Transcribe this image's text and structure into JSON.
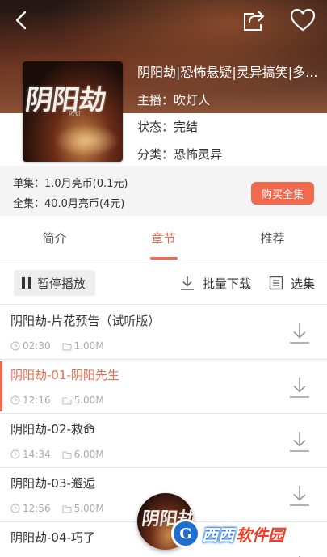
{
  "header": {
    "back_icon": "back-arrow-icon",
    "share_icon": "share-icon",
    "favorite_icon": "heart-icon"
  },
  "book": {
    "cover_text": "阴阳劫",
    "cover_author": "吹灯",
    "title": "阴阳劫|恐怖悬疑|灵异搞笑|多...",
    "host_label": "主播：",
    "host": "吹灯人",
    "status_label": "状态：",
    "status": "完结",
    "category_label": "分类：",
    "category": "恐怖灵异"
  },
  "price": {
    "single": "单集：1.0月亮币(0.1元)",
    "full": "全集：40.0月亮币(4元)",
    "buy_label": "购买全集"
  },
  "tabs": [
    {
      "label": "简介",
      "active": false
    },
    {
      "label": "章节",
      "active": true
    },
    {
      "label": "推荐",
      "active": false
    }
  ],
  "toolbar": {
    "pause_label": "暂停播放",
    "batch_download_label": "批量下载",
    "select_label": "选集"
  },
  "episodes": [
    {
      "title": "阴阳劫-片花预告（试听版）",
      "duration": "02:30",
      "size": "1.00M",
      "active": false
    },
    {
      "title": "阴阳劫-01-阴阳先生",
      "duration": "12:16",
      "size": "5.00M",
      "active": true
    },
    {
      "title": "阴阳劫-02-救命",
      "duration": "14:34",
      "size": "6.00M",
      "active": false
    },
    {
      "title": "阴阳劫-03-邂逅",
      "duration": "12:56",
      "size": "5.00M",
      "active": false
    },
    {
      "title": "阴阳劫-04-巧了",
      "duration": "",
      "size": "",
      "active": false
    }
  ],
  "mini_player": {
    "cover_text": "阴阳劫"
  },
  "watermark": {
    "logo_letter": "G",
    "text_main": "西西",
    "text_accent": "软件园"
  },
  "colors": {
    "accent": "#f06a4f"
  }
}
